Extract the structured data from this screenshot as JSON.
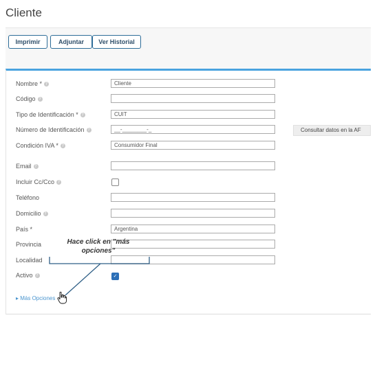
{
  "page": {
    "title": "Cliente"
  },
  "toolbar": {
    "print_label": "Imprimir",
    "attach_label": "Adjuntar",
    "history_label": "Ver Historial"
  },
  "form": {
    "nombre": {
      "label": "Nombre *",
      "value": "Cliente"
    },
    "codigo": {
      "label": "Código",
      "value": ""
    },
    "tipo_id": {
      "label": "Tipo de Identificación *",
      "value": "CUIT"
    },
    "numero_id": {
      "label": "Número de Identificación",
      "value": "__-________-_"
    },
    "consultar_afip_label": "Consultar datos en la AF",
    "condicion_iva": {
      "label": "Condición IVA *",
      "value": "Consumidor Final"
    },
    "email": {
      "label": "Email",
      "value": ""
    },
    "incluir_cc": {
      "label": "Incluir Cc/Cco",
      "checked": false
    },
    "telefono": {
      "label": "Teléfono",
      "value": ""
    },
    "domicilio": {
      "label": "Domicilio",
      "value": ""
    },
    "pais": {
      "label": "País *",
      "value": "Argentina"
    },
    "provincia": {
      "label": "Provincia",
      "value": ""
    },
    "localidad": {
      "label": "Localidad",
      "value": ""
    },
    "activo": {
      "label": "Activo",
      "checked": true,
      "check_glyph": "✓"
    },
    "more_options_label": "Más Opciones"
  },
  "help_icon_glyph": "?",
  "more_arrow_glyph": "▸",
  "annotation": {
    "text": "Hace click en \"más opciones\""
  },
  "colors": {
    "accent": "#4aa3df",
    "button_border": "#2c6c98",
    "link": "#4a95cf",
    "checkbox_on": "#2c6fb7"
  },
  "icons": [
    "help-icon",
    "caret-right-icon",
    "hand-cursor-icon",
    "check-icon"
  ]
}
